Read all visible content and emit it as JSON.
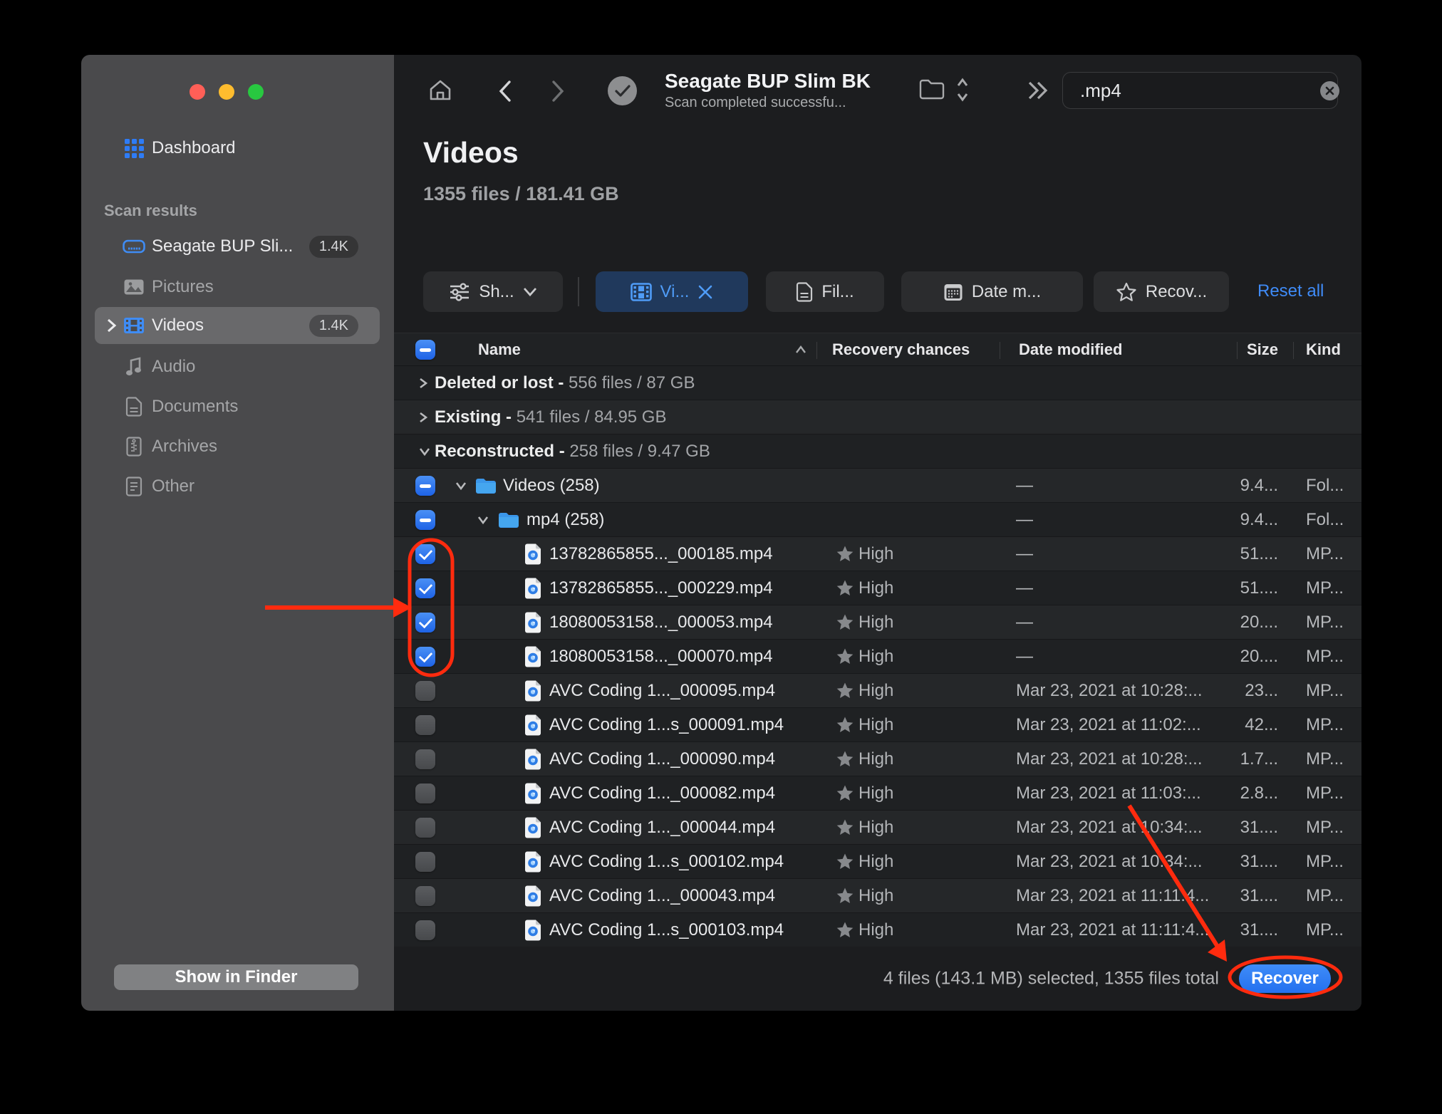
{
  "colors": {
    "accent_blue": "#2e7bf6",
    "chip_active_bg": "#20395c",
    "chip_active_text": "#4f9cf7",
    "annotation_red": "#ff2b0e",
    "sidebar_bg": "#4a4a4c",
    "content_bg": "#1c1d1f",
    "checkbox_blue": "#2476e8"
  },
  "sidebar": {
    "dashboard_label": "Dashboard",
    "section_label": "Scan results",
    "items": [
      {
        "id": "seagate",
        "label": "Seagate BUP Sli...",
        "badge": "1.4K",
        "icon": "drive-icon",
        "selected": false,
        "dimmed": false,
        "chevron": false
      },
      {
        "id": "pictures",
        "label": "Pictures",
        "badge": "",
        "icon": "pictures-icon",
        "selected": false,
        "dimmed": true,
        "chevron": false
      },
      {
        "id": "videos",
        "label": "Videos",
        "badge": "1.4K",
        "icon": "film-icon",
        "selected": true,
        "dimmed": false,
        "chevron": true
      },
      {
        "id": "audio",
        "label": "Audio",
        "badge": "",
        "icon": "music-icon",
        "selected": false,
        "dimmed": true,
        "chevron": false
      },
      {
        "id": "documents",
        "label": "Documents",
        "badge": "",
        "icon": "document-icon",
        "selected": false,
        "dimmed": true,
        "chevron": false
      },
      {
        "id": "archives",
        "label": "Archives",
        "badge": "",
        "icon": "archive-icon",
        "selected": false,
        "dimmed": true,
        "chevron": false
      },
      {
        "id": "other",
        "label": "Other",
        "badge": "",
        "icon": "other-icon",
        "selected": false,
        "dimmed": true,
        "chevron": false
      }
    ],
    "show_in_finder_label": "Show in Finder"
  },
  "toolbar": {
    "title": "Seagate BUP Slim BK",
    "subtitle": "Scan completed successfu...",
    "search_value": ".mp4"
  },
  "page": {
    "title": "Videos",
    "subtitle": "1355 files / 181.41 GB"
  },
  "filters": {
    "show_label": "Sh...",
    "video_chip": "Vi...",
    "files_chip": "Fil...",
    "date_chip": "Date m...",
    "recovery_chip": "Recov...",
    "reset_label": "Reset all"
  },
  "table": {
    "columns": {
      "name": "Name",
      "recovery": "Recovery chances",
      "date": "Date modified",
      "size": "Size",
      "kind": "Kind"
    },
    "rows": [
      {
        "type": "group",
        "expanded": false,
        "name": "Deleted or lost -",
        "meta": "556 files / 87 GB"
      },
      {
        "type": "group",
        "expanded": false,
        "name": "Existing -",
        "meta": "541 files / 84.95 GB"
      },
      {
        "type": "group",
        "expanded": true,
        "name": "Reconstructed -",
        "meta": "258 files / 9.47 GB"
      },
      {
        "type": "folder",
        "level": 1,
        "check": "indeterminate",
        "name": "Videos (258)",
        "date": "—",
        "size": "9.4...",
        "kind": "Fol..."
      },
      {
        "type": "folder",
        "level": 2,
        "check": "indeterminate",
        "name": "mp4 (258)",
        "date": "—",
        "size": "9.4...",
        "kind": "Fol..."
      },
      {
        "type": "file",
        "check": "checked",
        "name": "13782865855..._000185.mp4",
        "recovery": "High",
        "date": "—",
        "size": "51....",
        "kind": "MP..."
      },
      {
        "type": "file",
        "check": "checked",
        "name": "13782865855..._000229.mp4",
        "recovery": "High",
        "date": "—",
        "size": "51....",
        "kind": "MP..."
      },
      {
        "type": "file",
        "check": "checked",
        "name": "18080053158..._000053.mp4",
        "recovery": "High",
        "date": "—",
        "size": "20....",
        "kind": "MP..."
      },
      {
        "type": "file",
        "check": "checked",
        "name": "18080053158..._000070.mp4",
        "recovery": "High",
        "date": "—",
        "size": "20....",
        "kind": "MP..."
      },
      {
        "type": "file",
        "check": "unchecked",
        "name": "AVC Coding 1..._000095.mp4",
        "recovery": "High",
        "date": "Mar 23, 2021 at 10:28:...",
        "size": "23...",
        "kind": "MP..."
      },
      {
        "type": "file",
        "check": "unchecked",
        "name": "AVC Coding 1...s_000091.mp4",
        "recovery": "High",
        "date": "Mar 23, 2021 at 11:02:...",
        "size": "42...",
        "kind": "MP..."
      },
      {
        "type": "file",
        "check": "unchecked",
        "name": "AVC Coding 1..._000090.mp4",
        "recovery": "High",
        "date": "Mar 23, 2021 at 10:28:...",
        "size": "1.7...",
        "kind": "MP..."
      },
      {
        "type": "file",
        "check": "unchecked",
        "name": "AVC Coding 1..._000082.mp4",
        "recovery": "High",
        "date": "Mar 23, 2021 at 11:03:...",
        "size": "2.8...",
        "kind": "MP..."
      },
      {
        "type": "file",
        "check": "unchecked",
        "name": "AVC Coding 1..._000044.mp4",
        "recovery": "High",
        "date": "Mar 23, 2021 at 10:34:...",
        "size": "31....",
        "kind": "MP..."
      },
      {
        "type": "file",
        "check": "unchecked",
        "name": "AVC Coding 1...s_000102.mp4",
        "recovery": "High",
        "date": "Mar 23, 2021 at 10:34:...",
        "size": "31....",
        "kind": "MP..."
      },
      {
        "type": "file",
        "check": "unchecked",
        "name": "AVC Coding 1..._000043.mp4",
        "recovery": "High",
        "date": "Mar 23, 2021 at 11:11:4...",
        "size": "31....",
        "kind": "MP..."
      },
      {
        "type": "file",
        "check": "unchecked",
        "name": "AVC Coding 1...s_000103.mp4",
        "recovery": "High",
        "date": "Mar 23, 2021 at 11:11:4...",
        "size": "31....",
        "kind": "MP..."
      }
    ]
  },
  "footer": {
    "status": "4 files (143.1 MB) selected, 1355 files total",
    "recover_label": "Recover"
  }
}
